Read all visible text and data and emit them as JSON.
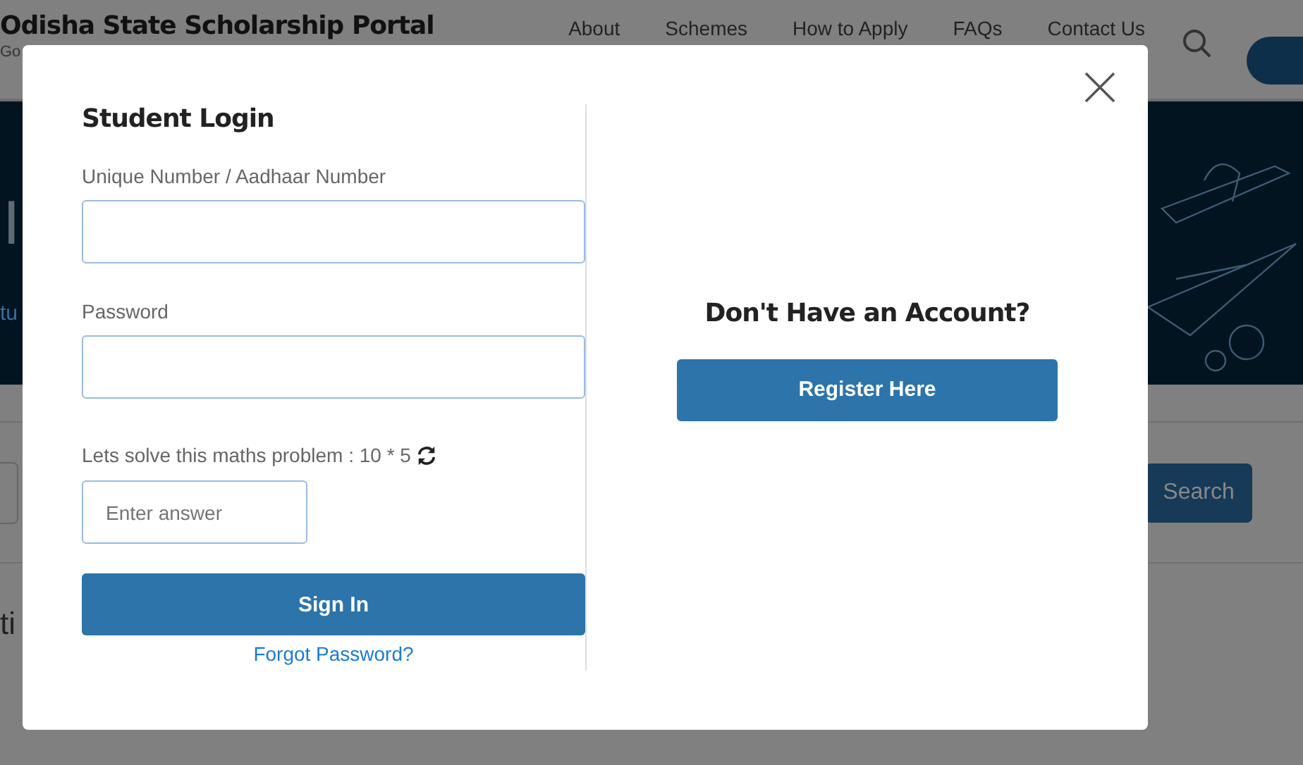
{
  "header": {
    "title": "Odisha State Scholarship Portal",
    "subtitle": "Go",
    "nav": [
      "About",
      "Schemes",
      "How to Apply",
      "FAQs",
      "Contact Us"
    ]
  },
  "banner": {
    "heading": "I",
    "subheading": "tu"
  },
  "filter": {
    "search_button": "Search"
  },
  "section": {
    "heading": "ti"
  },
  "modal": {
    "title": "Student Login",
    "fields": [
      {
        "label": "Unique Number / Aadhaar Number"
      },
      {
        "label": "Password"
      }
    ],
    "captcha": {
      "question": "Lets solve this maths problem : 10 * 5",
      "placeholder": "Enter answer"
    },
    "sign_in": "Sign In",
    "forgot": "Forgot Password?",
    "register_heading": "Don't Have an Account?",
    "register_button": "Register Here"
  }
}
